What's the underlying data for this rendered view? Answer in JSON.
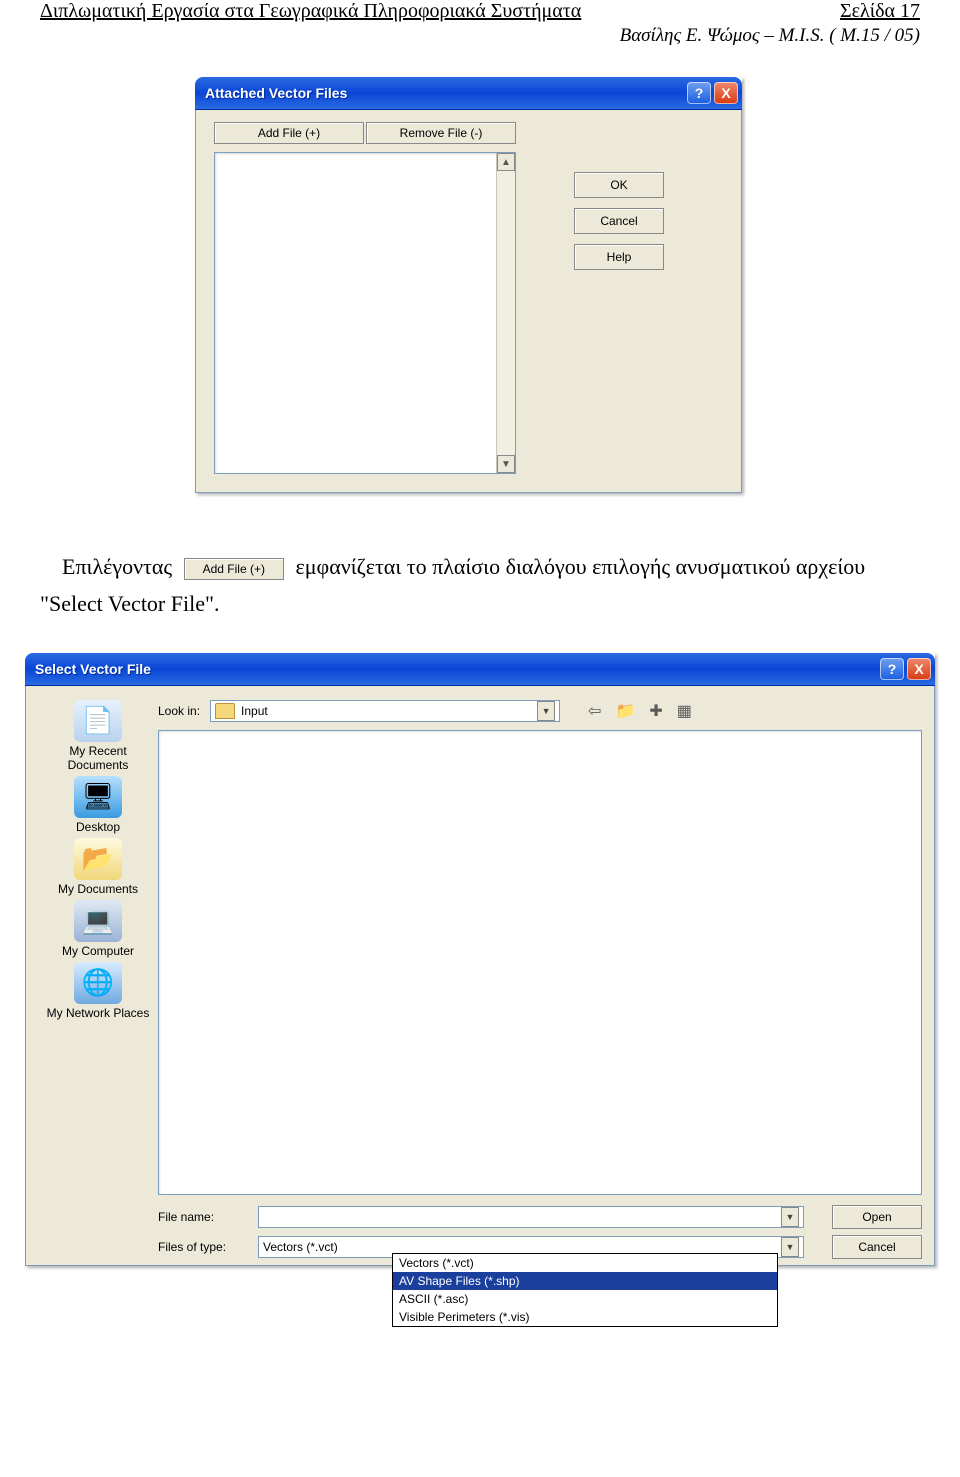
{
  "header": {
    "title": "Διπλωματική Εργασία στα Γεωγραφικά Πληροφοριακά Συστήματα",
    "page": "Σελίδα 17",
    "sub": "Βασίλης Ε. Ψώμος – M.I.S. ( Μ.15 / 05)"
  },
  "dlg1": {
    "title": "Attached Vector Files",
    "add": "Add File (+)",
    "remove": "Remove File (-)",
    "ok": "OK",
    "cancel": "Cancel",
    "help": "Help"
  },
  "para": {
    "t1": "Επιλέγοντας",
    "inline_btn": "Add File (+)",
    "t2": "εμφανίζεται το πλαίσιο διαλόγου επιλογής ανυσματικού αρχείου \"Select Vector File\"."
  },
  "dlg2": {
    "title": "Select Vector File",
    "lookin_label": "Look in:",
    "lookin_value": "Input",
    "places": {
      "recent": "My Recent Documents",
      "desktop": "Desktop",
      "docs": "My Documents",
      "computer": "My Computer",
      "network": "My Network Places"
    },
    "filename_label": "File name:",
    "filetype_label": "Files of type:",
    "filetype_value": "Vectors (*.vct)",
    "open": "Open",
    "cancel": "Cancel",
    "type_options": [
      "Vectors (*.vct)",
      "AV Shape Files (*.shp)",
      "ASCII (*.asc)",
      "Visible Perimeters (*.vis)"
    ],
    "type_selected_index": 1
  },
  "icons": {
    "help": "?",
    "close": "X",
    "up": "▲",
    "down": "▼",
    "dd": "▼",
    "back": "⇦",
    "upfolder": "📁",
    "newfolder": "✚",
    "views": "▦"
  }
}
